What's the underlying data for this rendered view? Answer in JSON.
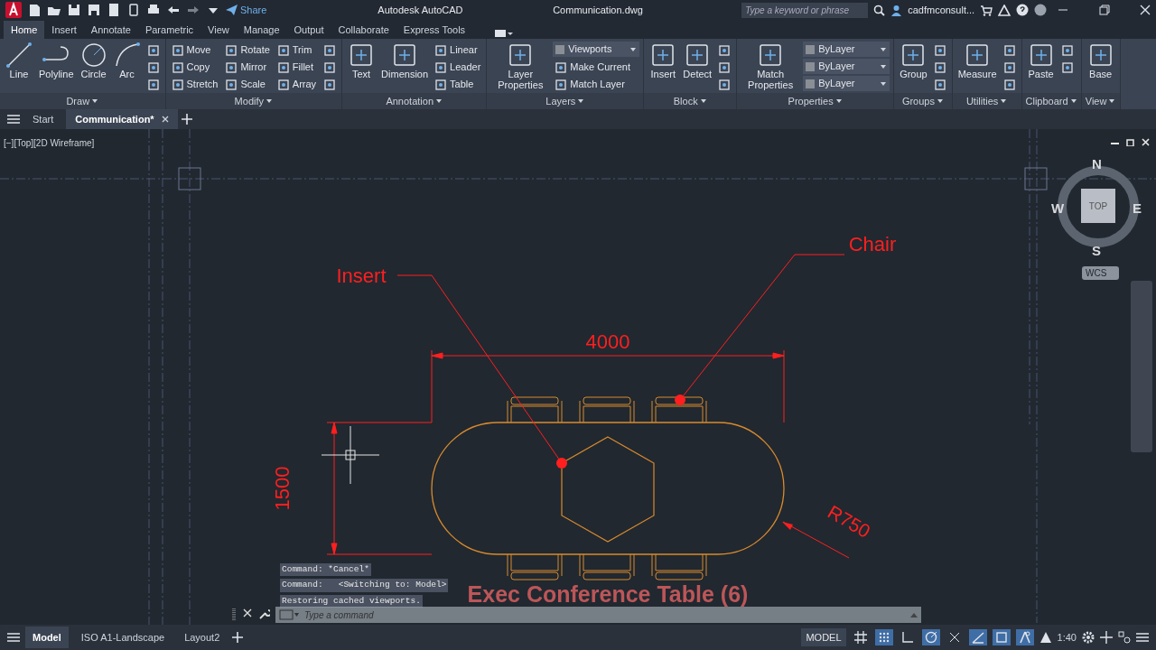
{
  "title_bar": {
    "share": "Share",
    "app": "Autodesk AutoCAD",
    "file": "Communication.dwg",
    "search": {
      "placeholder": "Type a keyword or phrase"
    },
    "user": "cadfmconsult..."
  },
  "ribbon_tabs": [
    {
      "label": "Home",
      "selected": true
    },
    {
      "label": "Insert",
      "selected": false
    },
    {
      "label": "Annotate",
      "selected": false
    },
    {
      "label": "Parametric",
      "selected": false
    },
    {
      "label": "View",
      "selected": false
    },
    {
      "label": "Manage",
      "selected": false
    },
    {
      "label": "Output",
      "selected": false
    },
    {
      "label": "Collaborate",
      "selected": false
    },
    {
      "label": "Express Tools",
      "selected": false
    }
  ],
  "panels": [
    {
      "title": "Draw",
      "tools": [
        {
          "kind": "large",
          "label": "Line"
        },
        {
          "kind": "large",
          "label": "Polyline"
        },
        {
          "kind": "large",
          "label": "Circle"
        },
        {
          "kind": "large",
          "label": "Arc"
        },
        {
          "kind": "icon"
        },
        {
          "kind": "icon"
        },
        {
          "kind": "icon"
        }
      ]
    },
    {
      "title": "Modify",
      "tools": [
        {
          "kind": "small",
          "label": "Move"
        },
        {
          "kind": "small",
          "label": "Copy"
        },
        {
          "kind": "small",
          "label": "Stretch"
        },
        {
          "kind": "small",
          "label": "Rotate"
        },
        {
          "kind": "small",
          "label": "Mirror"
        },
        {
          "kind": "small",
          "label": "Scale"
        },
        {
          "kind": "small",
          "label": "Trim"
        },
        {
          "kind": "small",
          "label": "Fillet"
        },
        {
          "kind": "small",
          "label": "Array"
        },
        {
          "kind": "icon"
        },
        {
          "kind": "icon"
        },
        {
          "kind": "icon"
        }
      ]
    },
    {
      "title": "Annotation",
      "tools": [
        {
          "kind": "large",
          "label": "Text"
        },
        {
          "kind": "large",
          "label": "Dimension"
        },
        {
          "kind": "small",
          "label": "Linear"
        },
        {
          "kind": "small",
          "label": "Leader"
        },
        {
          "kind": "small",
          "label": "Table"
        }
      ]
    },
    {
      "title": "Layers",
      "tools": [
        {
          "kind": "large",
          "label": "Layer Properties"
        },
        {
          "kind": "dropdown",
          "label": "Viewports"
        },
        {
          "kind": "small",
          "label": "Make Current"
        },
        {
          "kind": "small",
          "label": "Match Layer"
        }
      ]
    },
    {
      "title": "Block",
      "tools": [
        {
          "kind": "large",
          "label": "Insert"
        },
        {
          "kind": "large",
          "label": "Detect"
        },
        {
          "kind": "icon"
        },
        {
          "kind": "icon"
        },
        {
          "kind": "icon"
        }
      ]
    },
    {
      "title": "Properties",
      "tools": [
        {
          "kind": "large",
          "label": "Match Properties"
        },
        {
          "kind": "dropdown",
          "label": "ByLayer"
        },
        {
          "kind": "dropdown",
          "label": "ByLayer"
        },
        {
          "kind": "dropdown",
          "label": "ByLayer"
        }
      ]
    },
    {
      "title": "Groups",
      "tools": [
        {
          "kind": "large",
          "label": "Group"
        },
        {
          "kind": "icon"
        },
        {
          "kind": "icon"
        },
        {
          "kind": "icon"
        }
      ]
    },
    {
      "title": "Utilities",
      "tools": [
        {
          "kind": "large",
          "label": "Measure"
        },
        {
          "kind": "icon"
        },
        {
          "kind": "icon"
        },
        {
          "kind": "icon"
        }
      ]
    },
    {
      "title": "Clipboard",
      "tools": [
        {
          "kind": "large",
          "label": "Paste"
        },
        {
          "kind": "icon"
        },
        {
          "kind": "icon"
        }
      ]
    },
    {
      "title": "View",
      "tools": [
        {
          "kind": "large",
          "label": "Base"
        }
      ]
    }
  ],
  "file_tabs": [
    {
      "label": "Start",
      "selected": false
    },
    {
      "label": "Communication*",
      "selected": true
    }
  ],
  "viewport": {
    "controls": "[−][Top][2D Wireframe]",
    "viewcube": {
      "top": "TOP",
      "north": "N",
      "south": "S",
      "east": "E",
      "west": "W",
      "ucs": "WCS"
    }
  },
  "drawing": {
    "callouts": [
      {
        "label": "Insert"
      },
      {
        "label": "Chair"
      }
    ],
    "width_dimension": "4000",
    "depth_dimension": "1500",
    "radius_dimension": "R750",
    "title": "Exec Conference Table (6)"
  },
  "command_history": [
    "Command: *Cancel*",
    "Command:   <Switching to: Model>",
    "Restoring cached viewports."
  ],
  "command_line": {
    "placeholder": "Type a command"
  },
  "layout_tabs": [
    {
      "label": "Model",
      "selected": true
    },
    {
      "label": "ISO A1-Landscape",
      "selected": false
    },
    {
      "label": "Layout2",
      "selected": false
    }
  ],
  "status_bar": {
    "space": "MODEL",
    "toggles": [
      {
        "on": false
      },
      {
        "on": true
      },
      {
        "on": false
      },
      {
        "on": true
      },
      {
        "on": false
      },
      {
        "on": true
      },
      {
        "on": true
      },
      {
        "on": true
      }
    ],
    "scale": "1:40"
  }
}
